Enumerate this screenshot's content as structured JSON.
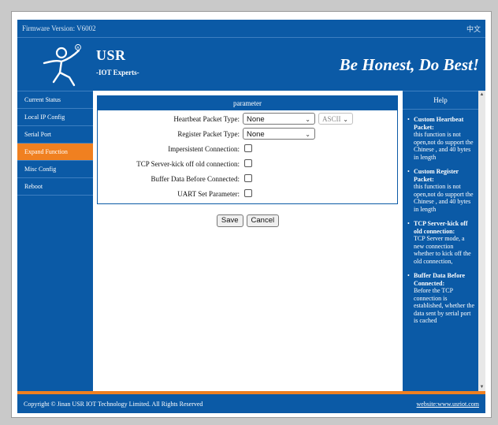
{
  "topbar": {
    "firmware": "Firmware Version: V6002",
    "language": "中文"
  },
  "header": {
    "brand": "USR",
    "subtitle": "-IOT Experts-",
    "slogan": "Be Honest, Do Best!"
  },
  "sidebar": {
    "items": [
      {
        "label": "Current Status",
        "active": false
      },
      {
        "label": "Local IP Config",
        "active": false
      },
      {
        "label": "Serial Port",
        "active": false
      },
      {
        "label": "Expand Function",
        "active": true
      },
      {
        "label": "Misc Config",
        "active": false
      },
      {
        "label": "Reboot",
        "active": false
      }
    ]
  },
  "panel": {
    "title": "parameter",
    "heartbeat": {
      "label": "Heartbeat Packet Type:",
      "value": "None",
      "encoding": "ASCII"
    },
    "register": {
      "label": "Register Packet Type:",
      "value": "None"
    },
    "impersistent": {
      "label": "Impersistent Connection:",
      "checked": false
    },
    "tcp_kick": {
      "label": "TCP Server-kick off old connection:",
      "checked": false
    },
    "buffer": {
      "label": "Buffer Data Before Connected:",
      "checked": false
    },
    "uart": {
      "label": "UART Set Parameter:",
      "checked": false
    }
  },
  "buttons": {
    "save": "Save",
    "cancel": "Cancel"
  },
  "help": {
    "title": "Help",
    "items": [
      {
        "head": "Custom Heartbeat Packet:",
        "body": "this function is not open,not do support the Chinese , and 40 bytes in length"
      },
      {
        "head": "Custom Register Packet:",
        "body": "this function is not open,not do support the Chinese , and 40 bytes in length"
      },
      {
        "head": "TCP Server-kick off old connection:",
        "body": "TCP Server mode, a new connection whether to kick off the old connection,"
      },
      {
        "head": "Buffer Data Before Connected:",
        "body": "Before the TCP connection is established, whether the data sent by serial port is cached"
      }
    ]
  },
  "footer": {
    "copyright": "Copyright © Jinan USR IOT Technology Limited. All Rights Reserved",
    "website": "website:www.usriot.com"
  },
  "colors": {
    "primary": "#0b5aa6",
    "accent": "#f08020"
  }
}
